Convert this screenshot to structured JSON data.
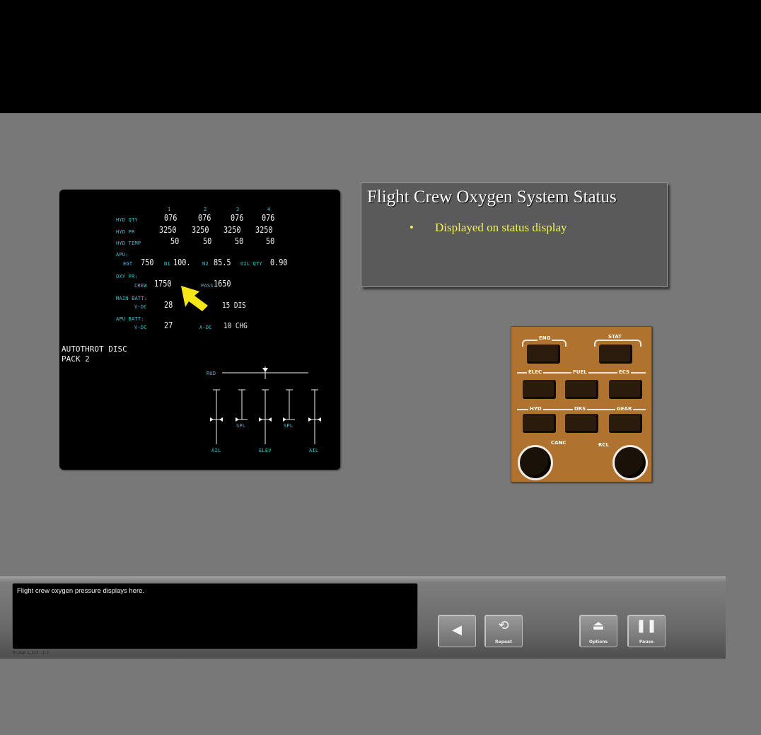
{
  "display": {
    "col_headers": [
      "1",
      "2",
      "3",
      "4"
    ],
    "rows": [
      {
        "label": "HYD QTY",
        "values": [
          "076",
          "076",
          "076",
          "076"
        ]
      },
      {
        "label": "HYD PR",
        "values": [
          "3250",
          "3250",
          "3250",
          "3250"
        ]
      },
      {
        "label": "HYD TEMP",
        "values": [
          "50",
          "50",
          "50",
          "50"
        ]
      }
    ],
    "apu": {
      "header": "APU:",
      "egt_label": "EGT",
      "egt_value": "750",
      "n1_label": "N1",
      "n1_value": "100.",
      "n2_label": "N2",
      "n2_value": "85.5",
      "oil_label": "OIL QTY",
      "oil_value": "0.90"
    },
    "oxy": {
      "header": "OXY PR:",
      "crew_label": "CREW",
      "crew_value": "1750",
      "pass_label": "PASS",
      "pass_value": "1650"
    },
    "main_batt": {
      "header": "MAIN BATT:",
      "vdc_label": "V-DC",
      "vdc_value": "28",
      "right_value": "15 DIS"
    },
    "apu_batt": {
      "header": "APU BATT:",
      "vdc_label": "V-DC",
      "vdc_value": "27",
      "adc_label": "A-DC",
      "adc_value": "10 CHG"
    },
    "messages": [
      "AUTOTHROT DISC",
      "PACK 2"
    ],
    "surfaces": {
      "rud": "RUD",
      "spl_left": "SPL",
      "spl_right": "SPL",
      "ail_left": "AIL",
      "elev": "ELEV",
      "ail_right": "AIL"
    }
  },
  "title_box": {
    "title": "Flight Crew Oxygen System Status",
    "bullet": "Displayed on status display"
  },
  "panel": {
    "eng": "ENG",
    "stat": "STAT",
    "elec": "ELEC",
    "fuel": "FUEL",
    "ecs": "ECS",
    "hyd": "HYD",
    "drs": "DRS",
    "gear": "GEAR",
    "canc": "CANC",
    "rcl": "RCL"
  },
  "caption": "Flight crew oxygen pressure displays here.",
  "footer_small": "Bridge  L.113 .1.1",
  "nav": {
    "back_icon": "back-arrow-icon",
    "repeat_label": "Repeat",
    "options_label": "Options",
    "pause_label": "Pause"
  },
  "colors": {
    "display_cyan": "#33c7d6",
    "title_yellow": "#f1f34a",
    "panel_brown": "#b0722f",
    "arrow_yellow": "#f5e61a"
  }
}
